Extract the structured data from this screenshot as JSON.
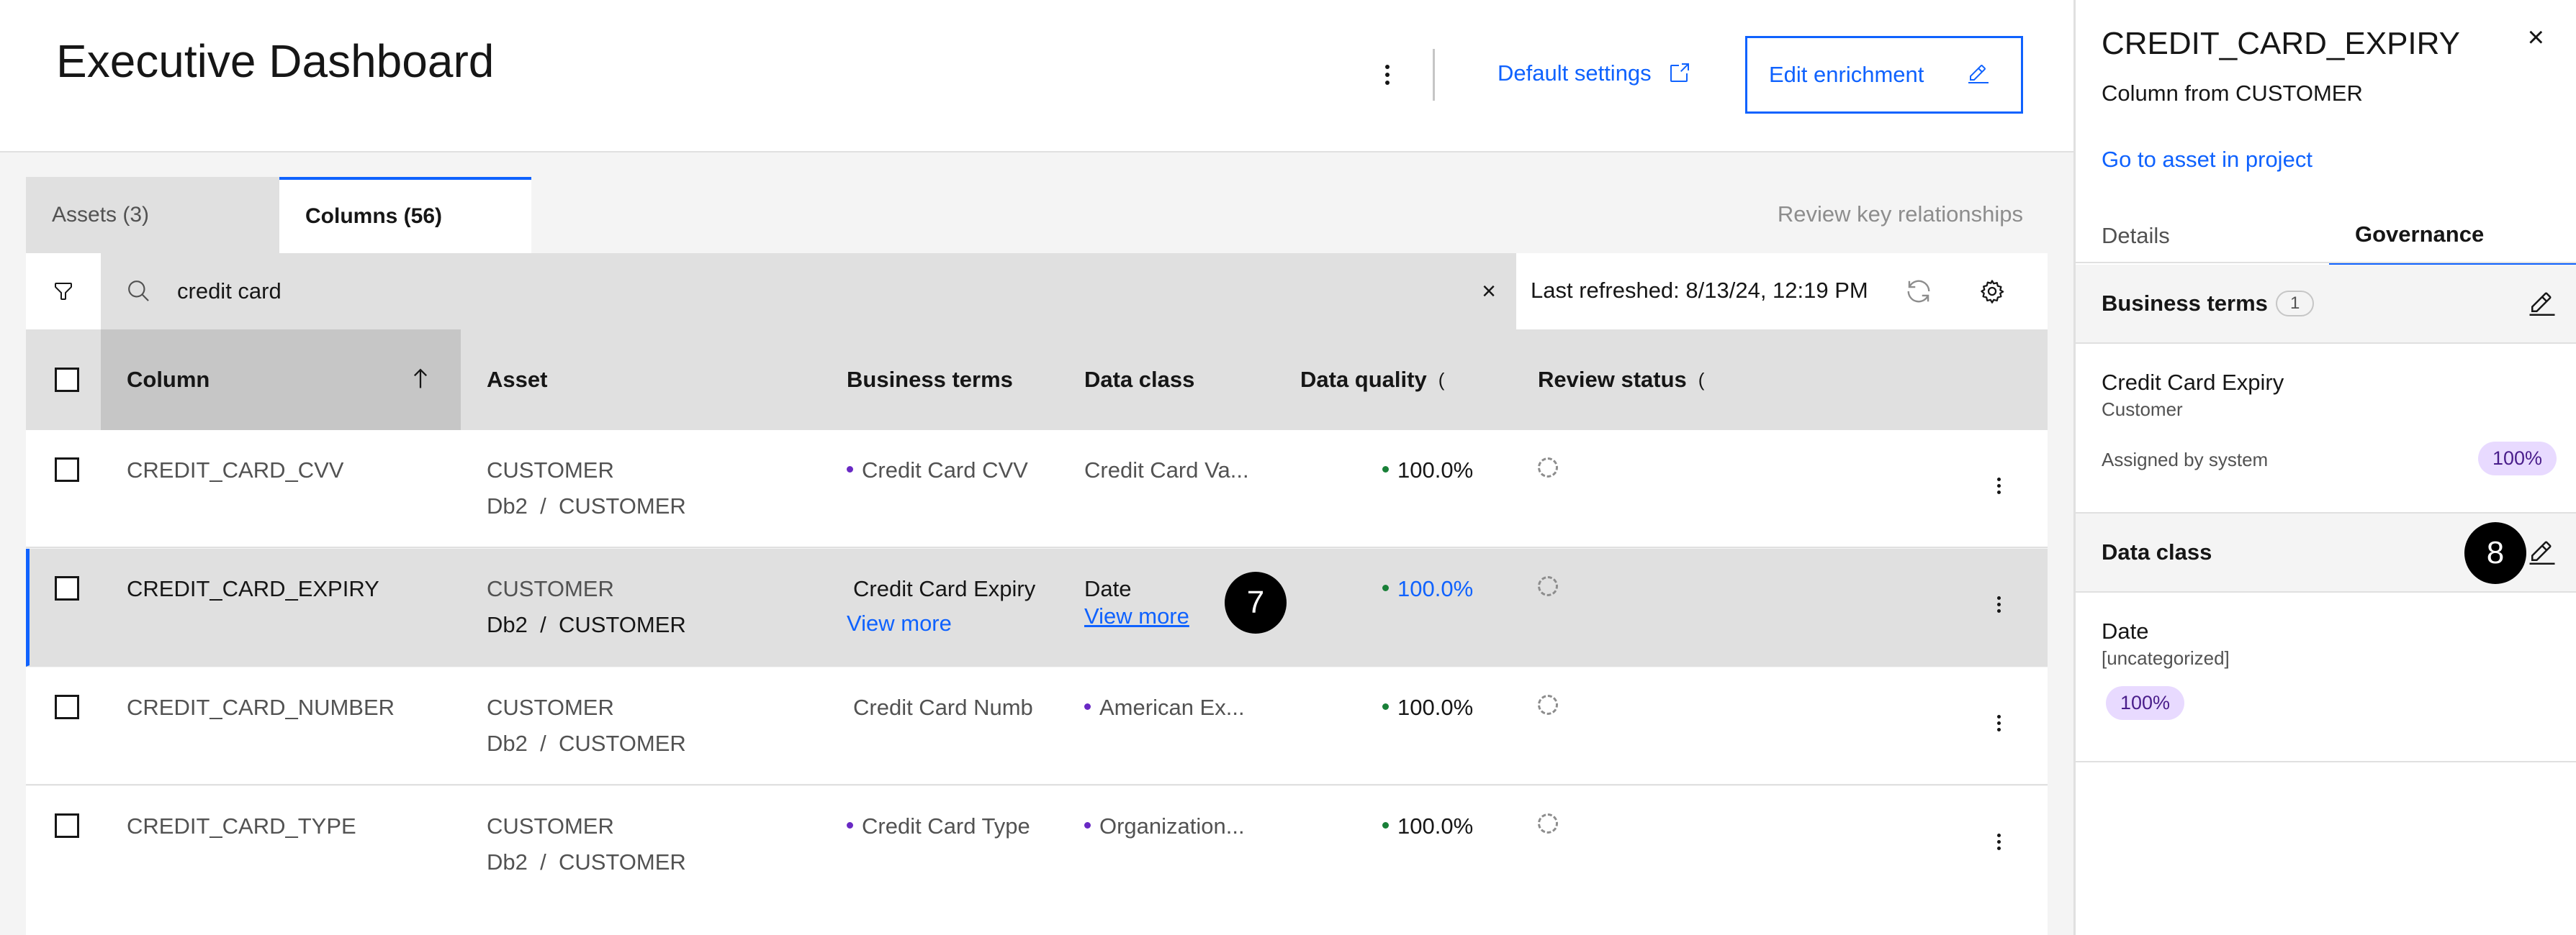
{
  "header": {
    "title": "Executive Dashboard",
    "default_settings_label": "Default settings",
    "edit_enrichment_label": "Edit enrichment"
  },
  "tabs": [
    {
      "label": "Assets (3)"
    },
    {
      "label": "Columns (56)"
    }
  ],
  "review_key_label": "Review key relationships",
  "toolbar": {
    "search_value": "credit card",
    "clear_icon": "×",
    "last_refreshed": "Last refreshed: 8/13/24, 12:19 PM"
  },
  "table": {
    "headers": {
      "column": "Column",
      "asset": "Asset",
      "business_terms": "Business terms",
      "data_class": "Data class",
      "data_quality": "Data quality",
      "review_status": "Review status",
      "truncated_marker": "("
    },
    "rows": [
      {
        "column": "CREDIT_CARD_CVV",
        "asset": "CUSTOMER",
        "asset_path_a": "Db2",
        "asset_sep": "/",
        "asset_path_b": "CUSTOMER",
        "business_term": "Credit Card CVV",
        "data_class": "Credit Card Va...",
        "data_quality": "100.0%"
      },
      {
        "column": "CREDIT_CARD_EXPIRY",
        "asset": "CUSTOMER",
        "asset_path_a": "Db2",
        "asset_sep": "/",
        "asset_path_b": "CUSTOMER",
        "business_term": "Credit Card Expiry",
        "business_term_more": "View more",
        "data_class": "Date",
        "data_class_more": "View more",
        "data_quality": "100.0%"
      },
      {
        "column": "CREDIT_CARD_NUMBER",
        "asset": "CUSTOMER",
        "asset_path_a": "Db2",
        "asset_sep": "/",
        "asset_path_b": "CUSTOMER",
        "business_term": "Credit Card Numb",
        "data_class": "American Ex...",
        "data_quality": "100.0%"
      },
      {
        "column": "CREDIT_CARD_TYPE",
        "asset": "CUSTOMER",
        "asset_path_a": "Db2",
        "asset_sep": "/",
        "asset_path_b": "CUSTOMER",
        "business_term": "Credit Card Type",
        "data_class": "Organization...",
        "data_quality": "100.0%"
      }
    ]
  },
  "callouts": {
    "seven": "7",
    "eight": "8"
  },
  "panel": {
    "title": "CREDIT_CARD_EXPIRY",
    "close_icon": "×",
    "subtitle": "Column from CUSTOMER",
    "go_to_asset": "Go to asset in project",
    "tabs": [
      {
        "label": "Details"
      },
      {
        "label": "Governance"
      }
    ],
    "business_terms": {
      "label": "Business terms",
      "count": "1",
      "term_name": "Credit Card Expiry",
      "term_category": "Customer",
      "assigned_by": "Assigned by system",
      "confidence": "100%"
    },
    "data_class": {
      "label": "Data class",
      "name": "Date",
      "category": "[uncategorized]",
      "confidence": "100%"
    }
  },
  "icons": {
    "overflow": "overflow-menu-vertical-icon",
    "launch": "launch-icon",
    "edit": "edit-pencil-icon",
    "filter": "filter-icon",
    "search": "search-icon",
    "refresh": "refresh-icon",
    "settings": "settings-gear-icon",
    "sort": "arrow-up-icon",
    "close": "close-icon"
  },
  "colors": {
    "accent": "#0f62fe",
    "selected_row": "#e0e0e0",
    "quality_dot": "#198038",
    "term_dot": "#6929c4",
    "confidence_pill": "#e8daff"
  }
}
